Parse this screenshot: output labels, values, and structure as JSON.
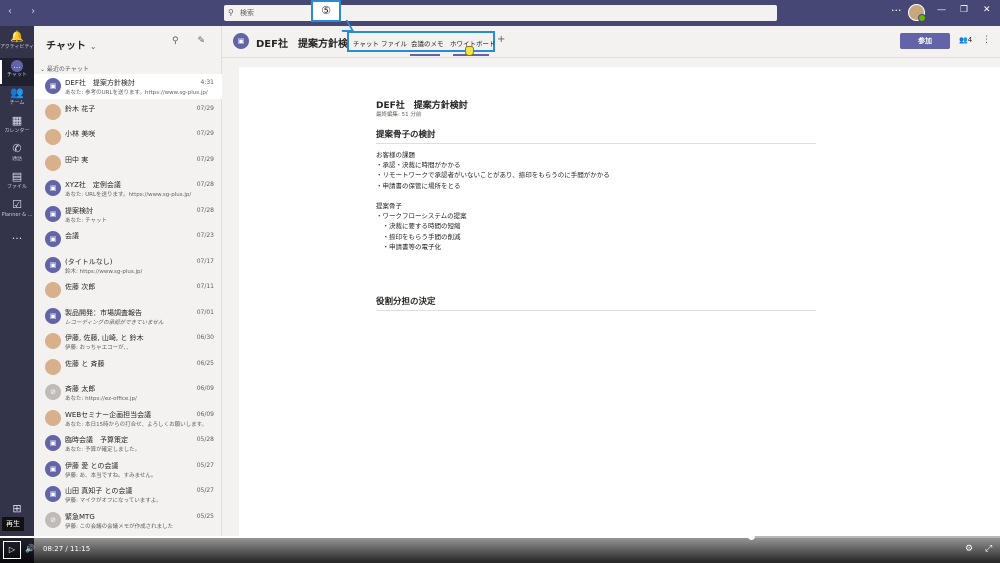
{
  "titlebar": {
    "nav": "‹ ›",
    "search_placeholder": "検索",
    "more": "···",
    "window_controls": [
      "—",
      "❐",
      "✕"
    ]
  },
  "rail": {
    "items": [
      {
        "icon": "bell-icon",
        "glyph": "🔔",
        "label": "アクティビティ"
      },
      {
        "icon": "chat-icon",
        "glyph": "…",
        "label": "チャット"
      },
      {
        "icon": "teams-icon",
        "glyph": "👥",
        "label": "チーム"
      },
      {
        "icon": "calendar-icon",
        "glyph": "▦",
        "label": "カレンダー"
      },
      {
        "icon": "phone-icon",
        "glyph": "✆",
        "label": "通話"
      },
      {
        "icon": "file-icon",
        "glyph": "▤",
        "label": "ファイル"
      },
      {
        "icon": "planner-icon",
        "glyph": "☑",
        "label": "Planner & ..."
      }
    ],
    "more": "···",
    "apps_icon": "⊞"
  },
  "chatlist": {
    "title": "チャット",
    "chevron": "⌄",
    "tools": "⚲ ✎",
    "section": "⌄ 最近のチャット",
    "chats": [
      {
        "name": "DEF社　提案方針検討",
        "preview": "あなた: 参考のURLを送ります。https://www.sg-plus.jp/",
        "time": "4:31",
        "type": "group",
        "selected": true
      },
      {
        "name": "鈴木 花子",
        "preview": "",
        "time": "07/29",
        "type": "person"
      },
      {
        "name": "小林 美咲",
        "preview": "",
        "time": "07/29",
        "type": "person"
      },
      {
        "name": "田中 実",
        "preview": "",
        "time": "07/29",
        "type": "person"
      },
      {
        "name": "XYZ社　定例会議",
        "preview": "あなた: URLを送ります。https://www.sg-plus.jp/",
        "time": "07/28",
        "type": "group"
      },
      {
        "name": "提案検討",
        "preview": "あなた: チャット",
        "time": "07/28",
        "type": "group"
      },
      {
        "name": "会議",
        "preview": "",
        "time": "07/23",
        "type": "group"
      },
      {
        "name": "(タイトルなし)",
        "preview": "鈴木: https://www.sg-plus.jp/",
        "time": "07/17",
        "type": "group"
      },
      {
        "name": "佐藤 次郎",
        "preview": "",
        "time": "07/11",
        "type": "person"
      },
      {
        "name": "製品開発：市場調査報告",
        "preview": "レコーディングの承認ができていません",
        "time": "07/01",
        "type": "group",
        "italic": true
      },
      {
        "name": "伊藤, 佐藤, 山崎, と 鈴木",
        "preview": "伊藤: おっちゃエコーが、、",
        "time": "06/30",
        "type": "person"
      },
      {
        "name": "佐藤 と 斉藤",
        "preview": "",
        "time": "06/25",
        "type": "person"
      },
      {
        "name": "斉藤 太郎",
        "preview": "あなた: https://ez-office.jp/",
        "time": "06/09",
        "type": "grey"
      },
      {
        "name": "WEBセミナー企画担当会議",
        "preview": "あなた: 本日15時からの打合せ、よろしくお願いします。",
        "time": "06/09",
        "type": "person"
      },
      {
        "name": "臨時会議　予算策定",
        "preview": "あなた: 予算が確定しました。",
        "time": "05/28",
        "type": "group"
      },
      {
        "name": "伊藤 愛 との会議",
        "preview": "伊藤: あ、本当ですね。すみません。",
        "time": "05/27",
        "type": "group"
      },
      {
        "name": "山田 真知子 との会議",
        "preview": "伊藤: マイクがオフになっていますよ。",
        "time": "05/27",
        "type": "group"
      },
      {
        "name": "緊急MTG",
        "preview": "伊藤: この会議の会議メモが作成されました",
        "time": "05/25",
        "type": "grey"
      }
    ]
  },
  "header": {
    "avatar_glyph": "▣",
    "title": "DEF社　提案方針検討",
    "tabs": [
      "チャット",
      "ファイル",
      "会議のメモ",
      "ホワイトボード"
    ],
    "add_tab": "+",
    "callout": "⑤",
    "join_label": "参加",
    "participants": "👥4",
    "more": "⋮"
  },
  "wiki": {
    "title": "DEF社　提案方針検討",
    "meta": "最終編集: 51 分前",
    "section1_title": "提案骨子の検討",
    "lines": [
      "お客様の課題",
      "・承認・決裁に時間がかかる",
      "・リモートワークで承認者がいないことがあり、捺印をもらうのに手間がかかる",
      "・申請書の保管に場所をとる",
      "",
      "提案骨子",
      "・ワークフローシステムの提案",
      "　・決裁に要する時間の短縮",
      "　・捺印をもらう手間の削減",
      "　・申請書等の電子化"
    ],
    "section2_title": "役割分担の決定"
  },
  "player": {
    "tooltip": "再生",
    "play_glyph": "▷",
    "volume_glyph": "🔊",
    "current_time": "08:27",
    "separator": " / ",
    "total_time": "11:15",
    "progress": 0.751,
    "settings_glyph": "⚙",
    "fullscreen_glyph": "⤢"
  },
  "colors": {
    "brand": "#6264a7",
    "titlebar": "#464775",
    "rail": "#33344a",
    "highlight": "#2a8ad4"
  }
}
